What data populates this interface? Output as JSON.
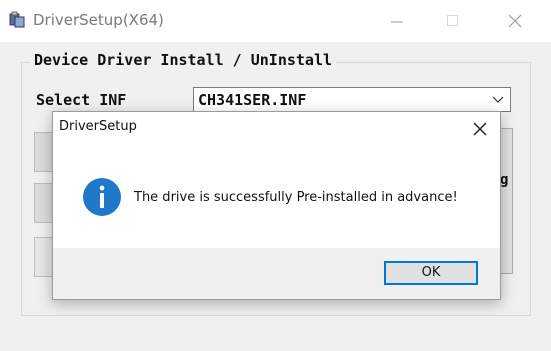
{
  "window": {
    "title": "DriverSetup(X64)",
    "icon": "driver-setup-app-icon",
    "controls": [
      "minimize",
      "maximize",
      "close"
    ]
  },
  "main": {
    "group_title": "Device Driver Install / UnInstall",
    "select_label": "Select INF",
    "inf_value": "CH341SER.INF",
    "right_fragment": "g"
  },
  "dialog": {
    "title": "DriverSetup",
    "icon": "info-icon",
    "message": "The drive is successfully Pre-installed in advance!",
    "ok_label": "OK"
  },
  "colors": {
    "accent": "#0078d7",
    "window_bg": "#f0f0f0",
    "info_icon": "#1f78c8"
  }
}
